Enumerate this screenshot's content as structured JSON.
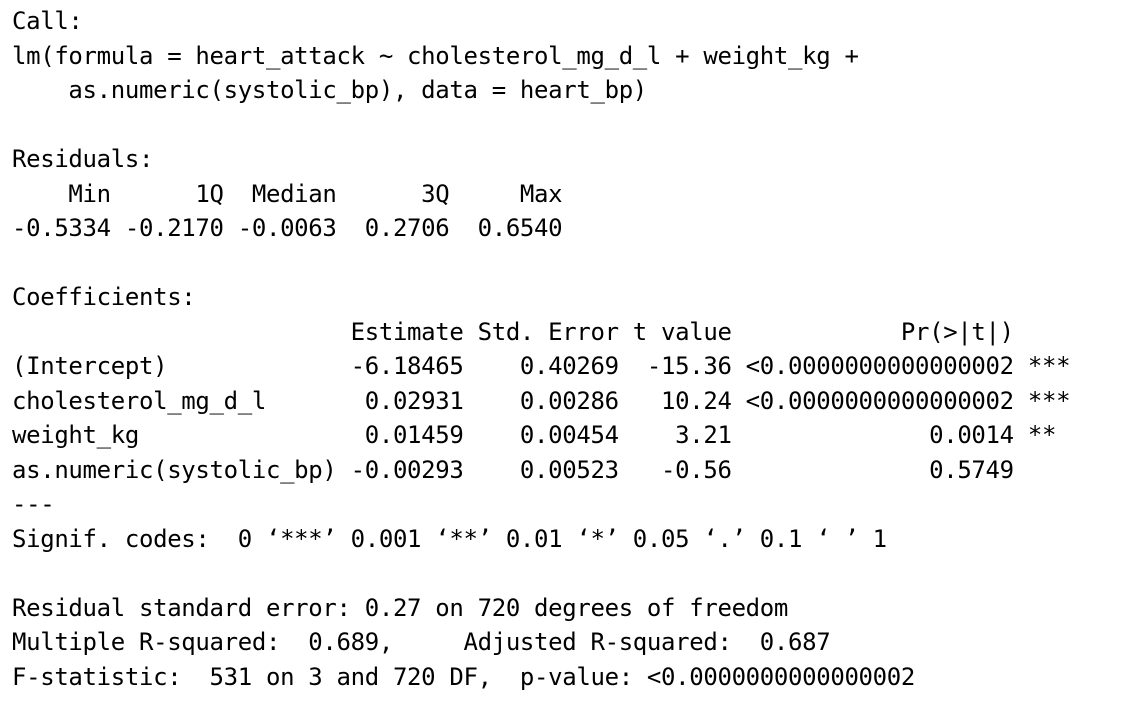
{
  "call": {
    "label": "Call:",
    "formula_line1": "lm(formula = heart_attack ~ cholesterol_mg_d_l + weight_kg +",
    "formula_line2": "    as.numeric(systolic_bp), data = heart_bp)"
  },
  "residuals": {
    "label": "Residuals:",
    "header": "    Min      1Q  Median      3Q     Max",
    "values": "-0.5334 -0.2170 -0.0063  0.2706  0.6540"
  },
  "coefficients": {
    "label": "Coefficients:",
    "header": "                        Estimate Std. Error t value            Pr(>|t|)    ",
    "rows": [
      "(Intercept)             -6.18465    0.40269  -15.36 <0.0000000000000002 ***",
      "cholesterol_mg_d_l       0.02931    0.00286   10.24 <0.0000000000000002 ***",
      "weight_kg                0.01459    0.00454    3.21              0.0014 ** ",
      "as.numeric(systolic_bp) -0.00293    0.00523   -0.56              0.5749    "
    ],
    "separator": "---",
    "signif_codes": "Signif. codes:  0 ‘***’ 0.001 ‘**’ 0.01 ‘*’ 0.05 ‘.’ 0.1 ‘ ’ 1"
  },
  "fit": {
    "rse": "Residual standard error: 0.27 on 720 degrees of freedom",
    "r_squared": "Multiple R-squared:  0.689,\tAdjusted R-squared:  0.687 ",
    "f_statistic": "F-statistic:  531 on 3 and 720 DF,  p-value: <0.0000000000000002"
  }
}
